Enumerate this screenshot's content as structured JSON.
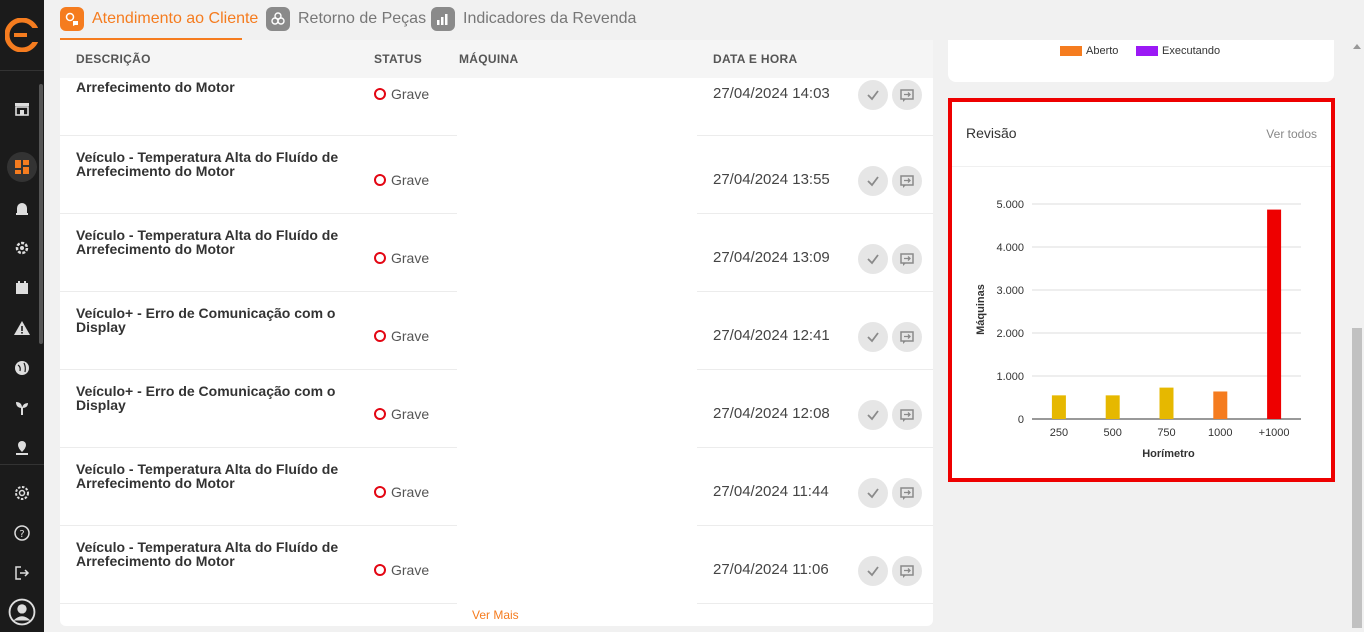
{
  "tabs": [
    {
      "label": "Atendimento ao Cliente",
      "icon": "chat-gear-icon",
      "active": true
    },
    {
      "label": "Retorno de Peças",
      "icon": "parts-icon",
      "active": false
    },
    {
      "label": "Indicadores da Revenda",
      "icon": "bar-chart-icon",
      "active": false
    }
  ],
  "table": {
    "headers": {
      "descricao": "DESCRIÇÃO",
      "status": "STATUS",
      "maquina": "MÁQUINA",
      "data": "DATA E HORA"
    },
    "rows": [
      {
        "desc": "Arrefecimento do Motor",
        "status": "Grave",
        "date": "27/04/2024 14:03"
      },
      {
        "desc": "Veículo - Temperatura Alta do Fluído de Arrefecimento do Motor",
        "status": "Grave",
        "date": "27/04/2024 13:55"
      },
      {
        "desc": "Veículo - Temperatura Alta do Fluído de Arrefecimento do Motor",
        "status": "Grave",
        "date": "27/04/2024 13:09"
      },
      {
        "desc": "Veículo+ - Erro de Comunicação com o Display",
        "status": "Grave",
        "date": "27/04/2024 12:41"
      },
      {
        "desc": "Veículo+ - Erro de Comunicação com o Display",
        "status": "Grave",
        "date": "27/04/2024 12:08"
      },
      {
        "desc": "Veículo - Temperatura Alta do Fluído de Arrefecimento do Motor",
        "status": "Grave",
        "date": "27/04/2024 11:44"
      },
      {
        "desc": "Veículo - Temperatura Alta do Fluído de Arrefecimento do Motor",
        "status": "Grave",
        "date": "27/04/2024 11:06"
      }
    ],
    "ver_mais": "Ver Mais"
  },
  "legend_card": {
    "items": [
      {
        "label": "Aberto",
        "color": "#f57c1f"
      },
      {
        "label": "Executando",
        "color": "#9b19f5"
      }
    ]
  },
  "revisao": {
    "title": "Revisão",
    "link": "Ver todos"
  },
  "chart_data": {
    "type": "bar",
    "title": "",
    "xlabel": "Horímetro",
    "ylabel": "Máquinas",
    "categories": [
      "250",
      "500",
      "750",
      "1000",
      "+1000"
    ],
    "values": [
      550,
      550,
      730,
      640,
      4870
    ],
    "colors": [
      "#e6b800",
      "#e6b800",
      "#e6b800",
      "#f57c1f",
      "#ee0000"
    ],
    "ylim": [
      0,
      5000
    ],
    "yticks": [
      0,
      1000,
      2000,
      3000,
      4000,
      5000
    ],
    "ytick_labels": [
      "0",
      "1.000",
      "2.000",
      "3.000",
      "4.000",
      "5.000"
    ],
    "grid": true
  }
}
